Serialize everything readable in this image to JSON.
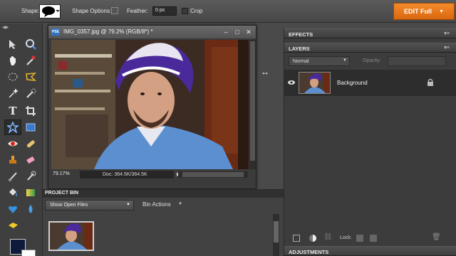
{
  "options_bar": {
    "shape_label": "Shape:",
    "shape_options_label": "Shape Options:",
    "feather_label": "Feather:",
    "feather_value": "0 px",
    "crop_label": "Crop",
    "edit_full_label": "EDIT Full",
    "edit_full_color": "#e8781b"
  },
  "document": {
    "title": "IMG_0357.jpg @ 79.2% (RGB/8*) *",
    "zoom": "79.17%",
    "doc_size": "Doc: 364.5K/364.5K",
    "icon_text": "PSE"
  },
  "project_bin": {
    "title": "PROJECT BIN",
    "show_select": "Show Open Files",
    "bin_actions": "Bin Actions"
  },
  "panels": {
    "effects_title": "EFFECTS",
    "layers_title": "LAYERS",
    "blend_mode": "Normal",
    "opacity_label": "Opacity:",
    "layer_name": "Background",
    "lock_label": "Lock:",
    "adjustments_title": "ADJUSTMENTS"
  },
  "tools": [
    {
      "icon": "move-icon"
    },
    {
      "icon": "zoom-icon"
    },
    {
      "icon": "hand-icon"
    },
    {
      "icon": "eyedropper-icon"
    },
    {
      "icon": "marquee-icon"
    },
    {
      "icon": "lasso-icon"
    },
    {
      "icon": "magic-wand-icon"
    },
    {
      "icon": "quick-selection-icon"
    },
    {
      "icon": "type-icon"
    },
    {
      "icon": "crop-icon"
    },
    {
      "icon": "cookie-cutter-icon"
    },
    {
      "icon": "straighten-icon"
    },
    {
      "icon": "red-eye-icon"
    },
    {
      "icon": "healing-brush-icon"
    },
    {
      "icon": "clone-stamp-icon"
    },
    {
      "icon": "eraser-icon"
    },
    {
      "icon": "brush-icon"
    },
    {
      "icon": "smart-brush-icon"
    },
    {
      "icon": "paint-bucket-icon"
    },
    {
      "icon": "gradient-icon"
    },
    {
      "icon": "custom-shape-icon"
    },
    {
      "icon": "blur-icon"
    },
    {
      "icon": "sponge-icon"
    }
  ]
}
